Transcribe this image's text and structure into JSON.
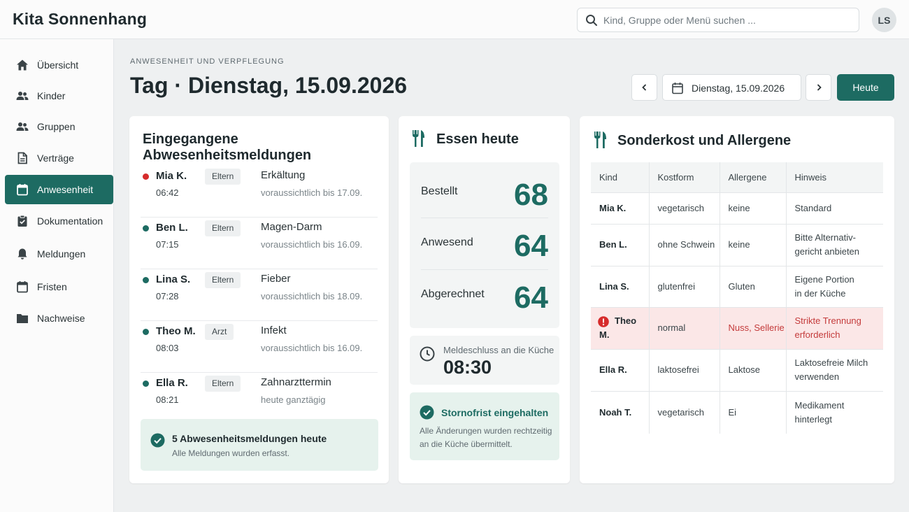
{
  "app": {
    "title": "Kita Sonnenhang",
    "user_initials": "LS"
  },
  "search": {
    "placeholder": "Kind, Gruppe oder Menü suchen ..."
  },
  "sidebar": {
    "items": [
      {
        "label": "Übersicht",
        "icon": "home-icon"
      },
      {
        "label": "Kinder",
        "icon": "children-icon"
      },
      {
        "label": "Gruppen",
        "icon": "groups-icon"
      },
      {
        "label": "Verträge",
        "icon": "document-icon"
      },
      {
        "label": "Anwesenheit",
        "icon": "calendar-icon",
        "active": true
      },
      {
        "label": "Dokumentation",
        "icon": "clipboard-icon"
      },
      {
        "label": "Meldungen",
        "icon": "bell-icon"
      },
      {
        "label": "Fristen",
        "icon": "calendar-icon"
      },
      {
        "label": "Nachweise",
        "icon": "folder-icon"
      }
    ]
  },
  "header": {
    "eyebrow": "ANWESENHEIT UND VERPFLEGUNG",
    "title": "Tag · Dienstag, 15.09.2026",
    "date_value": "Dienstag, 15.09.2026",
    "today_label": "Heute"
  },
  "absences": {
    "title": "Eingegangene Abwesenheitsmeldungen",
    "rows": [
      {
        "name": "Mia K.",
        "time": "06:42",
        "source": "Eltern",
        "reason": "Erkältung",
        "until": "voraussichtlich bis 17.09.",
        "dot": "#d62b2b"
      },
      {
        "name": "Ben L.",
        "time": "07:15",
        "source": "Eltern",
        "reason": "Magen-Darm",
        "until": "voraussichtlich bis 16.09.",
        "dot": "#1d6b62"
      },
      {
        "name": "Lina S.",
        "time": "07:28",
        "source": "Eltern",
        "reason": "Fieber",
        "until": "voraussichtlich bis 18.09.",
        "dot": "#1d6b62"
      },
      {
        "name": "Theo M.",
        "time": "08:03",
        "source": "Arzt",
        "reason": "Infekt",
        "until": "voraussichtlich bis 16.09.",
        "dot": "#1d6b62"
      },
      {
        "name": "Ella R.",
        "time": "08:21",
        "source": "Eltern",
        "reason": "Zahnarzttermin",
        "until": "heute ganztägig",
        "dot": "#1d6b62"
      }
    ],
    "summary_title": "5 Abwesenheitsmeldungen heute",
    "summary_text": "Alle Meldungen wurden erfasst."
  },
  "meals": {
    "title": "Essen heute",
    "stats": [
      {
        "label": "Bestellt",
        "value": "68"
      },
      {
        "label": "Anwesend",
        "value": "64"
      },
      {
        "label": "Abgerechnet",
        "value": "64"
      }
    ],
    "deadline_label": "Meldeschluss an die Küche",
    "deadline_time": "08:30",
    "status_title": "Stornofrist eingehalten",
    "status_text_1": "Alle Änderungen wurden rechtzeitig",
    "status_text_2": "an die Küche übermittelt."
  },
  "diet": {
    "title": "Sonderkost und Allergene",
    "columns": [
      "Kind",
      "Kostform",
      "Allergene",
      "Hinweis"
    ],
    "rows": [
      {
        "kid": "Mia K.",
        "diet": "vegetarisch",
        "allergens": "keine",
        "note_1": "Standard",
        "note_2": ""
      },
      {
        "kid": "Ben L.",
        "diet": "ohne Schwein",
        "allergens": "keine",
        "note_1": "Bitte Alternativ-",
        "note_2": "gericht anbieten"
      },
      {
        "kid": "Lina S.",
        "diet": "glutenfrei",
        "allergens": "Gluten",
        "note_1": "Eigene Portion",
        "note_2": "in der Küche"
      },
      {
        "kid": "Theo M.",
        "diet": "normal",
        "allergens": "Nuss, Sellerie",
        "note_1": "Strikte Trennung",
        "note_2": "erforderlich",
        "alert": true
      },
      {
        "kid": "Ella R.",
        "diet": "laktosefrei",
        "allergens": "Laktose",
        "note_1": "Laktosefreie Milch",
        "note_2": "verwenden"
      },
      {
        "kid": "Noah T.",
        "diet": "vegetarisch",
        "allergens": "Ei",
        "note_1": "Medikament",
        "note_2": "hinterlegt"
      }
    ]
  },
  "colors": {
    "accent": "#1d6b62",
    "alert": "#d62b2b",
    "alert_bg": "#fbe7e7",
    "success_bg": "#e6f2ed"
  }
}
